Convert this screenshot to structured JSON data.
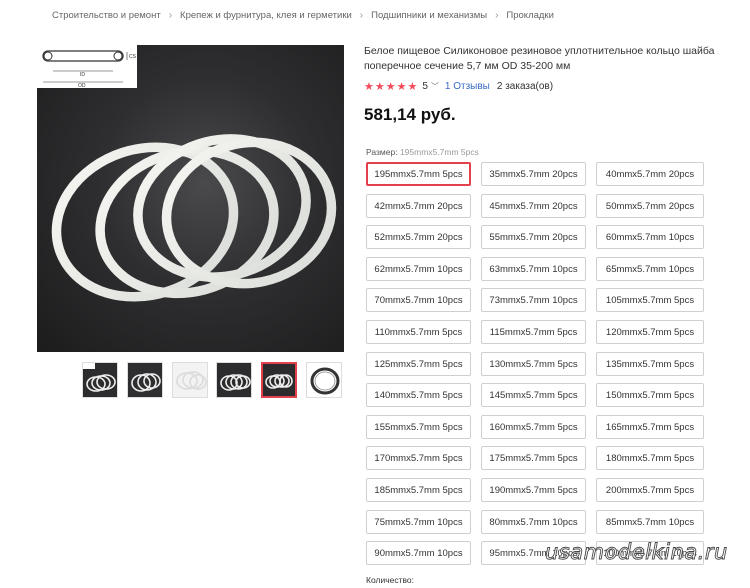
{
  "breadcrumb": {
    "items": [
      "Строительство и ремонт",
      "Крепеж и фурнитура, клея и герметики",
      "Подшипники и механизмы",
      "Прокладки"
    ],
    "separator": "›"
  },
  "gallery": {
    "diagram_labels": {
      "cs": "CS",
      "id": "ID",
      "od": "OD"
    },
    "thumbnails": [
      {
        "name": "thumb-1",
        "active": false
      },
      {
        "name": "thumb-2",
        "active": false
      },
      {
        "name": "thumb-3",
        "active": false
      },
      {
        "name": "thumb-4",
        "active": true
      },
      {
        "name": "thumb-5",
        "active": false
      }
    ]
  },
  "product": {
    "title": "Белое пищевое Силиконовое резиновое уплотнительное кольцо шайба поперечное сечение 5,7 мм OD 35-200 мм",
    "rating_stars": "★★★★★",
    "rating_value": "5",
    "rating_chevron": "﹀",
    "reviews": "1 Отзывы",
    "orders": "2 заказа(ов)",
    "price": "581,14 руб."
  },
  "size": {
    "label": "Размер:",
    "selected_value": "195mmx5.7mm 5pcs",
    "options": [
      "195mmx5.7mm 5pcs",
      "35mmx5.7mm 20pcs",
      "40mmx5.7mm 20pcs",
      "42mmx5.7mm 20pcs",
      "45mmx5.7mm 20pcs",
      "50mmx5.7mm 20pcs",
      "52mmx5.7mm 20pcs",
      "55mmx5.7mm 20pcs",
      "60mmx5.7mm 10pcs",
      "62mmx5.7mm 10pcs",
      "63mmx5.7mm 10pcs",
      "65mmx5.7mm 10pcs",
      "70mmx5.7mm 10pcs",
      "73mmx5.7mm 10pcs",
      "105mmx5.7mm 5pcs",
      "110mmx5.7mm 5pcs",
      "115mmx5.7mm 5pcs",
      "120mmx5.7mm 5pcs",
      "125mmx5.7mm 5pcs",
      "130mmx5.7mm 5pcs",
      "135mmx5.7mm 5pcs",
      "140mmx5.7mm 5pcs",
      "145mmx5.7mm 5pcs",
      "150mmx5.7mm 5pcs",
      "155mmx5.7mm 5pcs",
      "160mmx5.7mm 5pcs",
      "165mmx5.7mm 5pcs",
      "170mmx5.7mm 5pcs",
      "175mmx5.7mm 5pcs",
      "180mmx5.7mm 5pcs",
      "185mmx5.7mm 5pcs",
      "190mmx5.7mm 5pcs",
      "200mmx5.7mm 5pcs",
      "75mmx5.7mm 10pcs",
      "80mmx5.7mm 10pcs",
      "85mmx5.7mm 10pcs",
      "90mmx5.7mm 10pcs",
      "95mmx5.7mm 10pcs",
      "100mmx5.7mm 10pcs"
    ]
  },
  "quantity": {
    "label": "Количество:"
  },
  "watermark": "usamodelkina.ru",
  "colors": {
    "accent": "#e2404a",
    "star": "#f44b5c",
    "link": "#3a6cc4"
  }
}
